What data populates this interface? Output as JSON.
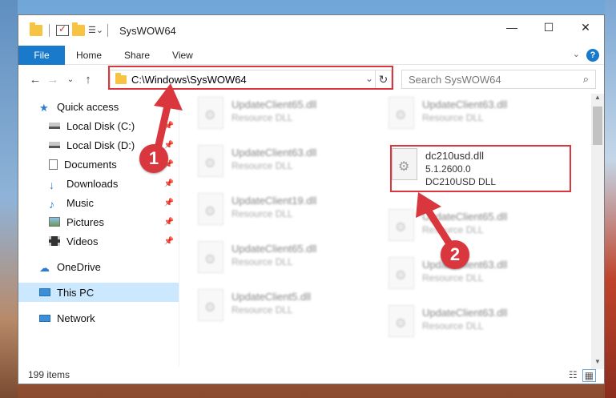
{
  "window": {
    "title": "SysWOW64",
    "controls": {
      "minimize": "—",
      "maximize": "☐",
      "close": "✕"
    }
  },
  "ribbon": {
    "tabs": [
      "File",
      "Home",
      "Share",
      "View"
    ],
    "help": "?",
    "expand": "⌄"
  },
  "nav": {
    "back": "←",
    "forward": "→",
    "recent": "⌄",
    "up": "↑",
    "address": "C:\\Windows\\SysWOW64",
    "address_dropdown": "⌄",
    "refresh": "↻",
    "search_placeholder": "Search SysWOW64",
    "search_icon": "search-icon"
  },
  "sidebar": {
    "items": [
      {
        "label": "Quick access",
        "icon": "star-icon",
        "pinned": false
      },
      {
        "label": "Local Disk (C:)",
        "icon": "drive-icon",
        "pinned": true
      },
      {
        "label": "Local Disk (D:)",
        "icon": "drive-icon",
        "pinned": true
      },
      {
        "label": "Documents",
        "icon": "documents-icon",
        "pinned": true
      },
      {
        "label": "Downloads",
        "icon": "download-icon",
        "pinned": true
      },
      {
        "label": "Music",
        "icon": "music-icon",
        "pinned": true
      },
      {
        "label": "Pictures",
        "icon": "pictures-icon",
        "pinned": true
      },
      {
        "label": "Videos",
        "icon": "videos-icon",
        "pinned": true
      },
      {
        "label": "OneDrive",
        "icon": "cloud-icon",
        "pinned": false
      },
      {
        "label": "This PC",
        "icon": "computer-icon",
        "pinned": false,
        "selected": true
      },
      {
        "label": "Network",
        "icon": "network-icon",
        "pinned": false
      }
    ]
  },
  "files": {
    "left_column": [
      {
        "name": "UpdateClient65.dll",
        "type": "Resource DLL"
      },
      {
        "name": "UpdateClient63.dll",
        "type": "Resource DLL"
      },
      {
        "name": "UpdateClient19.dll",
        "type": "Resource DLL"
      },
      {
        "name": "UpdateClient65.dll",
        "type": "Resource DLL"
      },
      {
        "name": "UpdateClient5.dll",
        "type": "Resource DLL"
      }
    ],
    "right_column": [
      {
        "name": "UpdateClient63.dll",
        "type": "Resource DLL"
      },
      {
        "name": "dc210usd.dll",
        "version": "5.1.2600.0",
        "type": "DC210USD DLL",
        "highlighted": true
      },
      {
        "name": "UpdateClient65.dll",
        "type": "Resource DLL"
      },
      {
        "name": "UpdateClient63.dll",
        "type": "Resource DLL"
      },
      {
        "name": "UpdateClient63.dll",
        "type": "Resource DLL"
      }
    ]
  },
  "status": {
    "count": "199 items"
  },
  "markers": {
    "one": "1",
    "two": "2"
  },
  "colors": {
    "accent": "#1979ca",
    "highlight": "#d9363e",
    "selected_bg": "#cce8ff"
  }
}
